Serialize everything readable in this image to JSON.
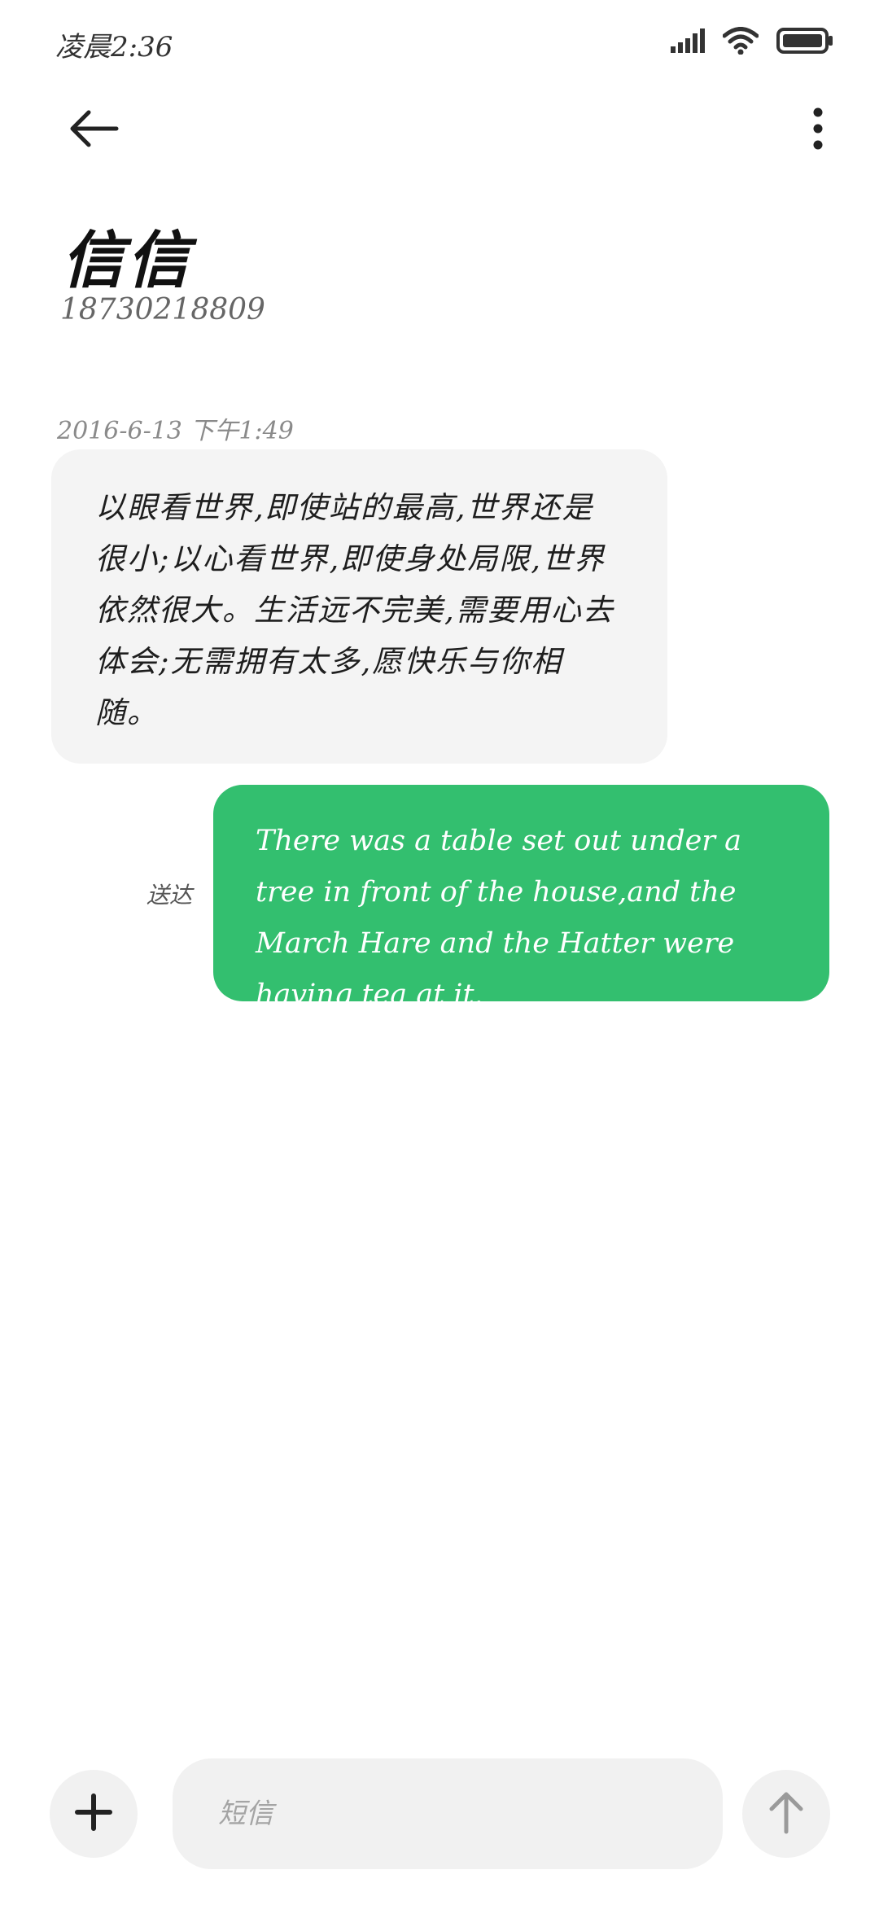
{
  "status_bar": {
    "time": "凌晨2:36",
    "icons": [
      "signal-icon",
      "wifi-icon",
      "battery-icon"
    ]
  },
  "top_bar": {
    "back_icon": "back-arrow-icon",
    "more_icon": "more-vertical-icon"
  },
  "contact": {
    "name": "信信",
    "number": "18730218809"
  },
  "conversation": {
    "timestamp": "2016-6-13 下午1:49",
    "messages": [
      {
        "direction": "incoming",
        "text": "以眼看世界,即使站的最高,世界还是很小;以心看世界,即使身处局限,世界依然很大。生活远不完美,需要用心去体会;无需拥有太多,愿快乐与你相随。"
      },
      {
        "direction": "outgoing",
        "status": "送达",
        "text": "There was a table set out under a tree in front of the house,and the March Hare and the Hatter were having tea at it."
      }
    ]
  },
  "composer": {
    "placeholder": "短信",
    "value": "",
    "attach_icon": "plus-icon",
    "send_icon": "send-arrow-up-icon"
  },
  "colors": {
    "outgoing_bubble": "#33bf6f",
    "incoming_bubble": "#f4f4f4",
    "composer_bg": "#f1f1f1"
  }
}
